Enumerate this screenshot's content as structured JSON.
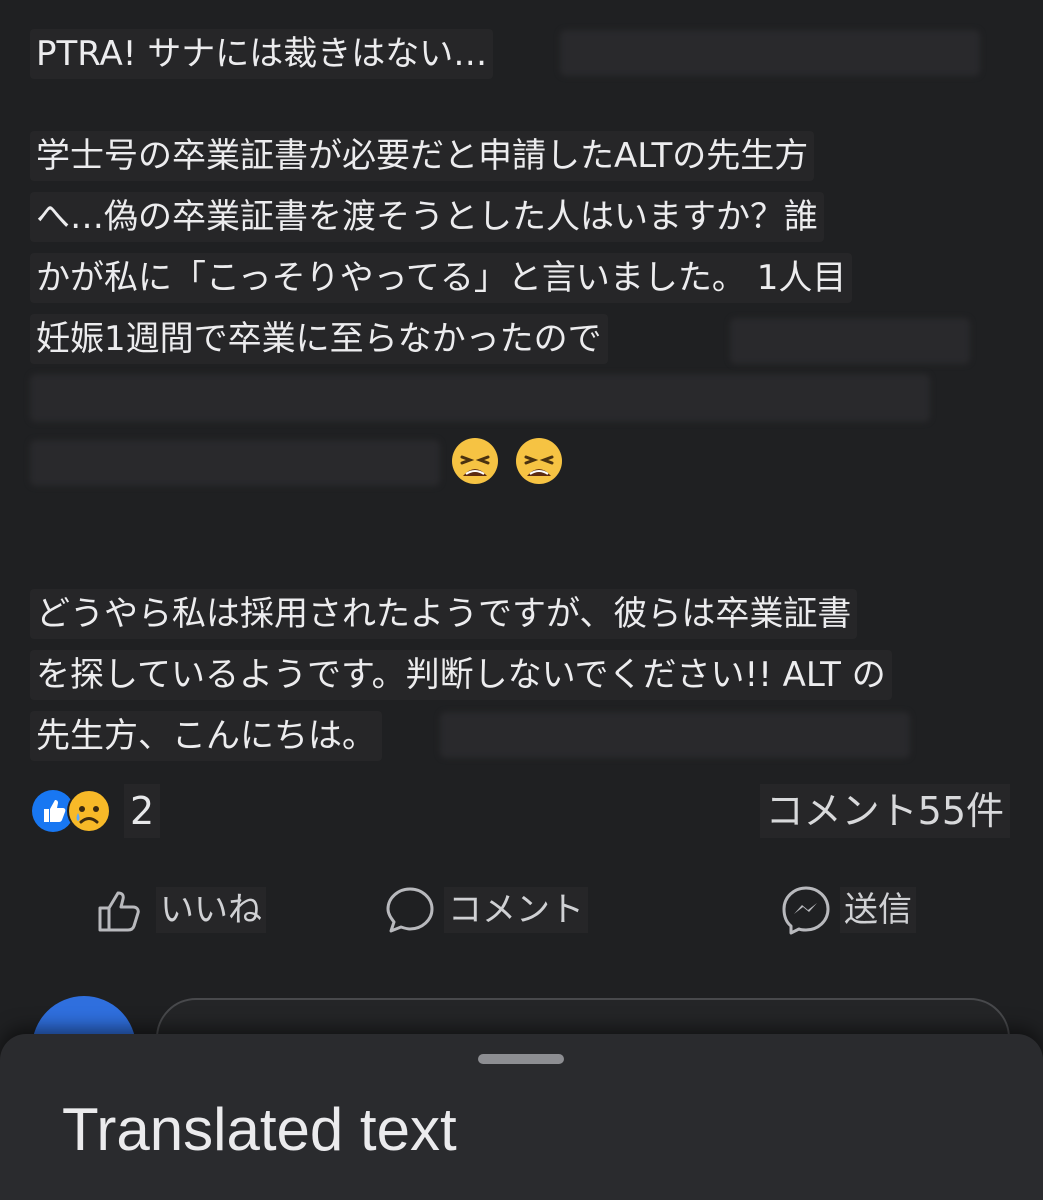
{
  "post": {
    "lines": [
      "PTRA! サナには裁きはない…",
      "学士号の卒業証書が必要だと申請したALTの先生方",
      "へ…偽の卒業証書を渡そうとした人はいますか？誰",
      "かが私に「こっそりやってる」と言いました。 1人目",
      "妊娠1週間で卒業に至らなかったので",
      "どうやら私は採用されたようですが、彼らは卒業証書",
      "を探しているようです。判断しないでください!! ALT の",
      "先生方、こんにちは。"
    ],
    "emojis": [
      "weary-face",
      "weary-face"
    ]
  },
  "stats": {
    "reactions": [
      "like",
      "sad"
    ],
    "reaction_count": "2",
    "comment_count": "コメント55件"
  },
  "actions": {
    "like": "いいね",
    "comment": "コメント",
    "send": "送信"
  },
  "sheet": {
    "title": "Translated text"
  },
  "colors": {
    "background": "#1f2022",
    "text": "#ececee",
    "like_blue": "#1877f2",
    "avatar_blue": "#2f6fde",
    "sheet": "#2a2b2e"
  }
}
